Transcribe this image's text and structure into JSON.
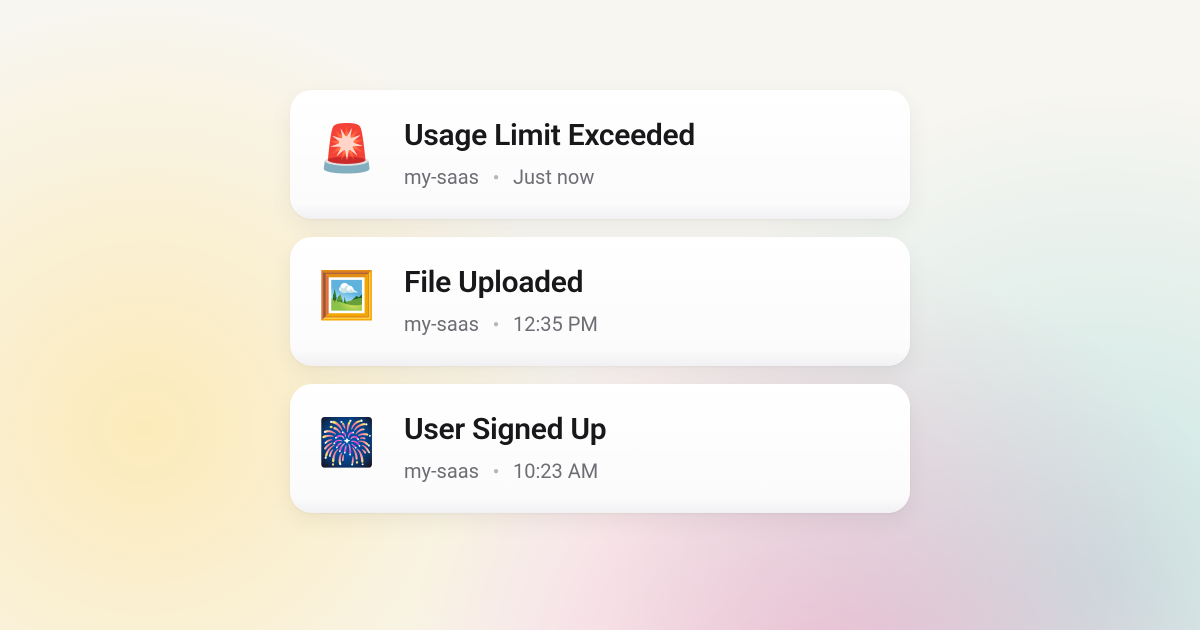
{
  "notifications": [
    {
      "icon_name": "siren-icon",
      "emoji": "🚨",
      "title": "Usage Limit Exceeded",
      "source": "my-saas",
      "time": "Just now"
    },
    {
      "icon_name": "picture-icon",
      "emoji": "🖼️",
      "title": "File Uploaded",
      "source": "my-saas",
      "time": "12:35 PM"
    },
    {
      "icon_name": "fireworks-icon",
      "emoji": "🎆",
      "title": "User Signed Up",
      "source": "my-saas",
      "time": "10:23 AM"
    }
  ]
}
